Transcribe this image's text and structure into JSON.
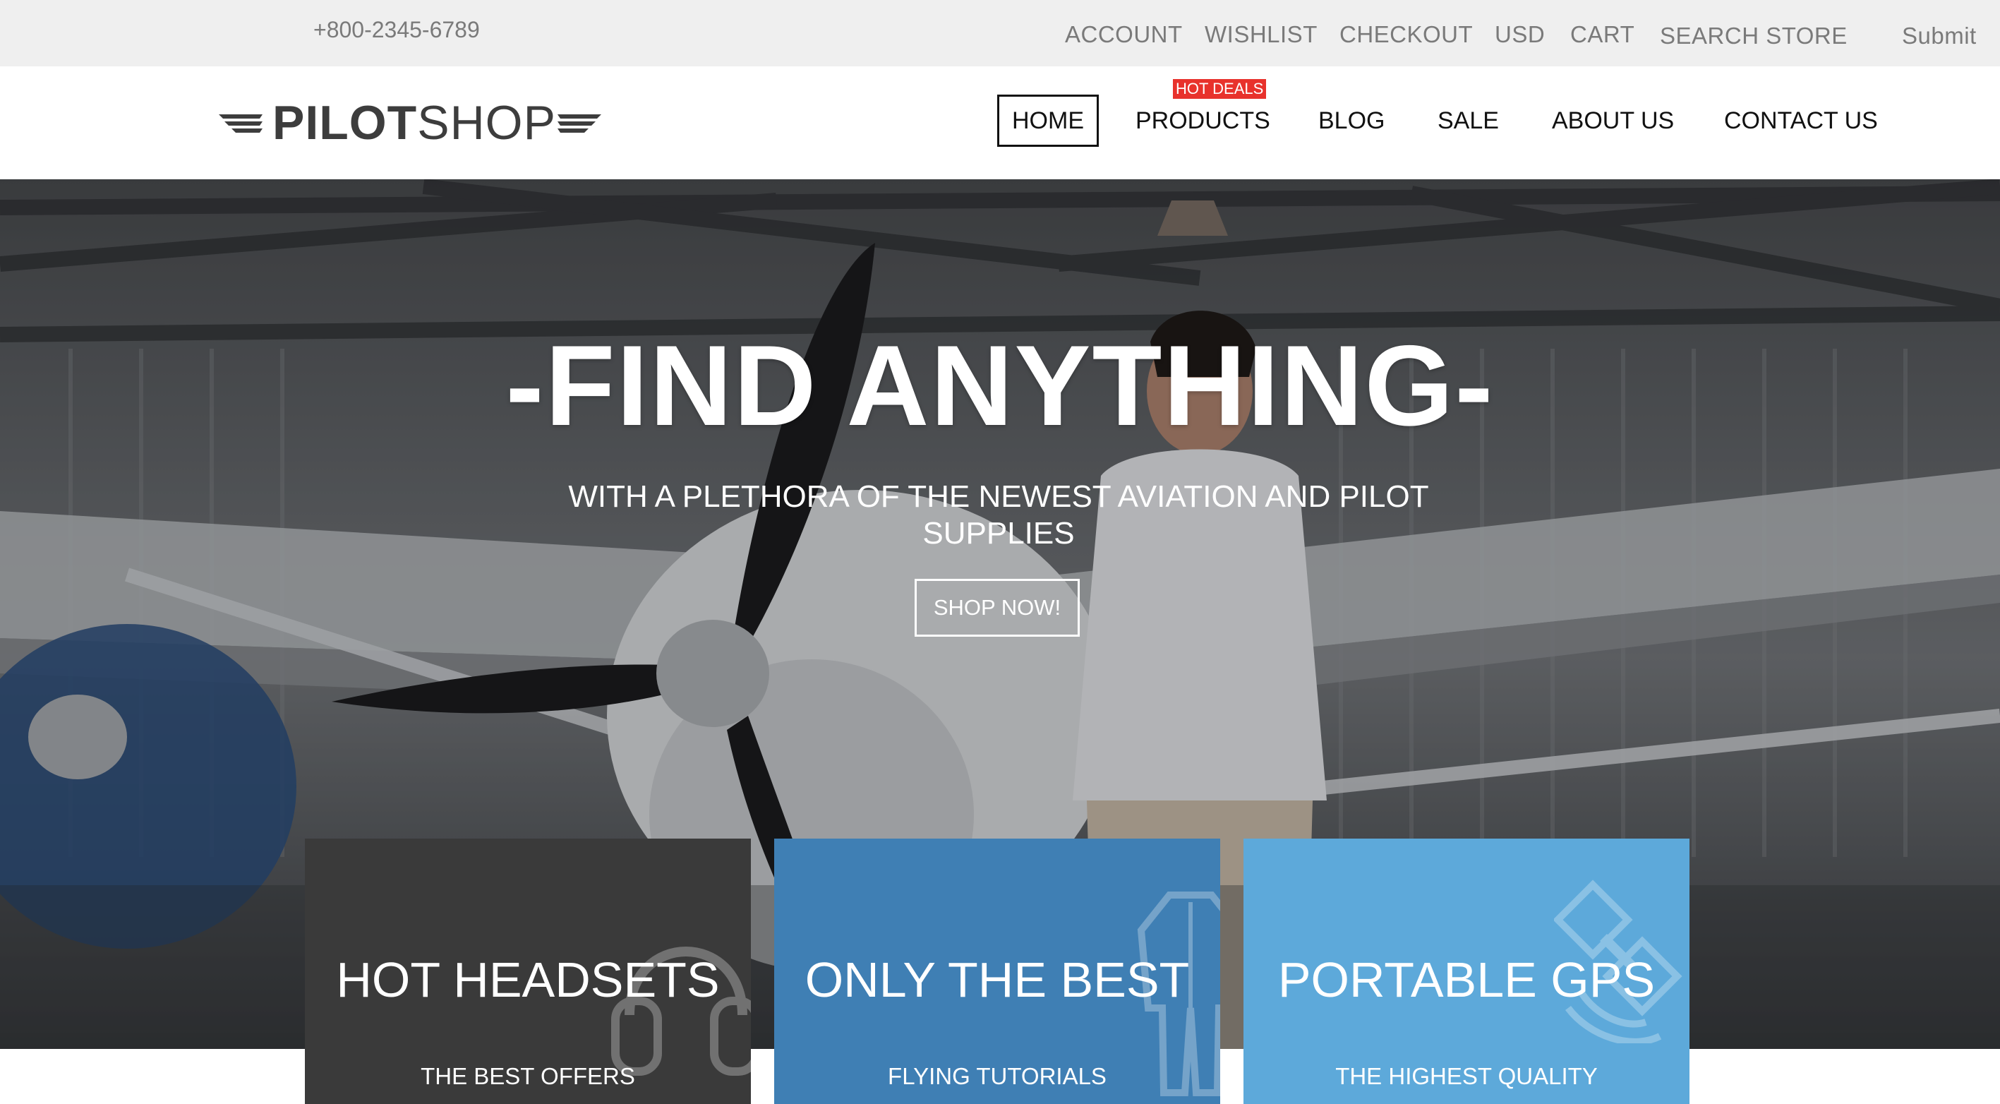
{
  "topbar": {
    "phone": "+800-2345-6789",
    "links": [
      "ACCOUNT",
      "WISHLIST",
      "CHECKOUT",
      "USD",
      "CART",
      "SEARCH STORE",
      "Submit"
    ]
  },
  "header": {
    "logo": {
      "bold": "PILOT",
      "light": "SHOP"
    },
    "nav": [
      "HOME",
      "PRODUCTS",
      "BLOG",
      "SALE",
      "ABOUT US",
      "CONTACT US"
    ],
    "active_nav": "HOME",
    "badge": "HOT DEALS"
  },
  "hero": {
    "title": "-FIND ANYTHING-",
    "subtitle": "WITH A PLETHORA OF THE NEWEST AVIATION AND PILOT SUPPLIES",
    "cta": "SHOP NOW!"
  },
  "cards": [
    {
      "title": "HOT HEADSETS",
      "subtitle": "THE BEST OFFERS",
      "icon": "headset-icon"
    },
    {
      "title": "ONLY THE BEST",
      "subtitle": "FLYING TUTORIALS",
      "icon": "flight-suit-icon"
    },
    {
      "title": "PORTABLE GPS",
      "subtitle": "THE HIGHEST QUALITY",
      "icon": "satellite-icon"
    }
  ],
  "colors": {
    "topbar_bg": "#efefef",
    "badge_red": "#e8322c",
    "card_dark": "#3a3a3a",
    "card_blue": "#3f7fb4",
    "card_light_blue": "#5da9da"
  }
}
